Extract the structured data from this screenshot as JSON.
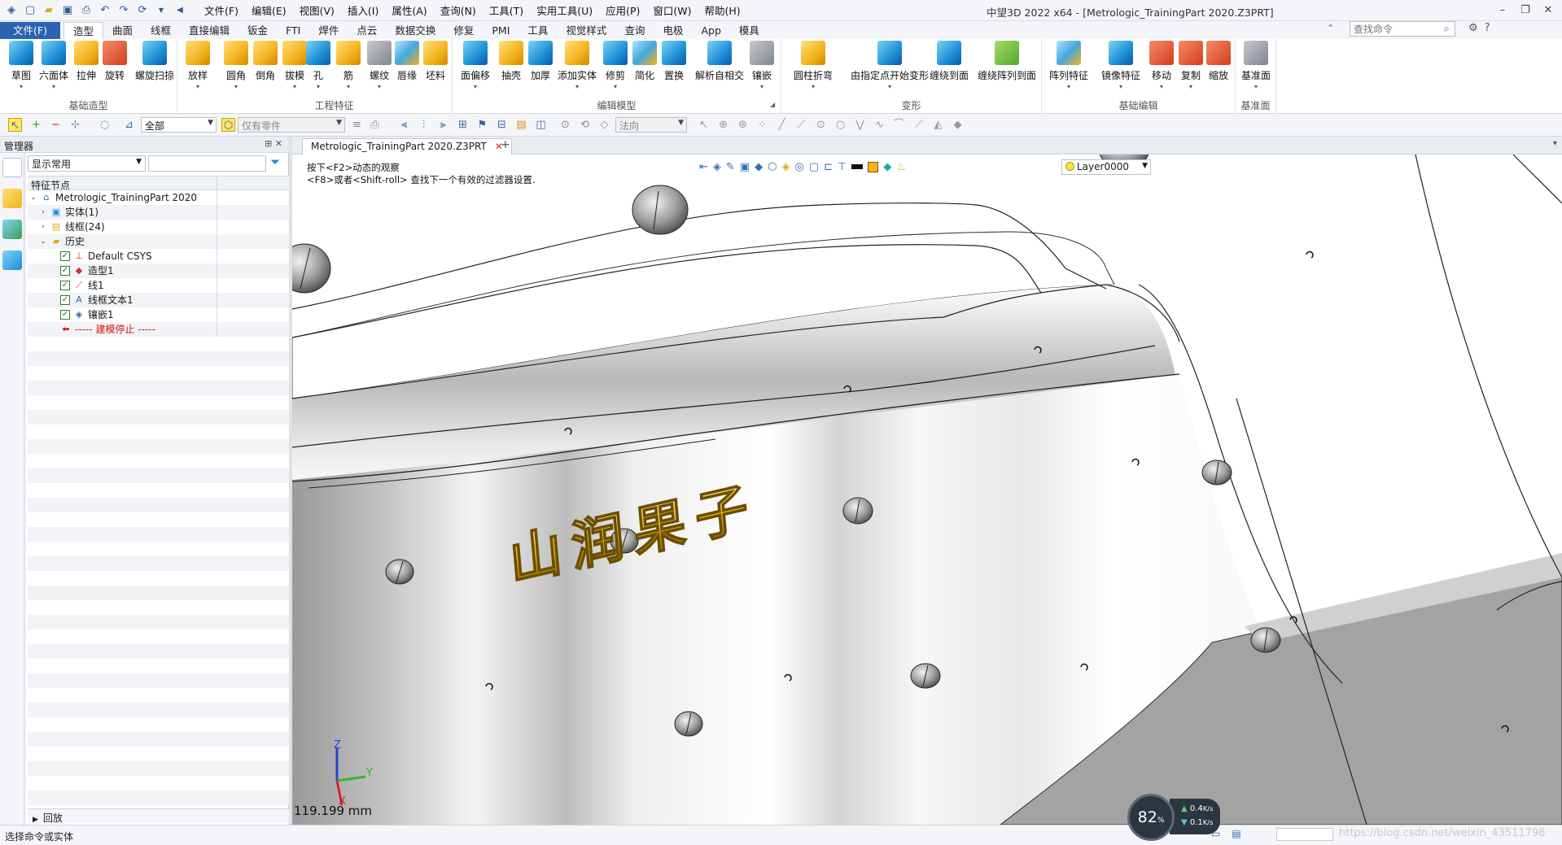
{
  "titlebar": {
    "window_title": "中望3D 2022 x64 - [Metrologic_TrainingPart 2020.Z3PRT]",
    "menus": [
      "文件(F)",
      "编辑(E)",
      "视图(V)",
      "插入(I)",
      "属性(A)",
      "查询(N)",
      "工具(T)",
      "实用工具(U)",
      "应用(P)",
      "窗口(W)",
      "帮助(H)"
    ]
  },
  "ribbon_tabs": [
    "文件(F)",
    "造型",
    "曲面",
    "线框",
    "直接编辑",
    "钣金",
    "FTI",
    "焊件",
    "点云",
    "数据交换",
    "修复",
    "PMI",
    "工具",
    "视觉样式",
    "查询",
    "电极",
    "App",
    "模具"
  ],
  "active_tab": "造型",
  "search": {
    "placeholder": "查找命令"
  },
  "groups": [
    {
      "label": "基础造型",
      "buttons": [
        "草图",
        "六面体",
        "拉伸",
        "旋转",
        "螺旋扫掠",
        "放样"
      ]
    },
    {
      "label": "工程特征",
      "buttons": [
        "圆角",
        "倒角",
        "拔模",
        "孔",
        "筋",
        "螺纹",
        "唇缘",
        "坯料"
      ]
    },
    {
      "label": "编辑模型",
      "buttons": [
        "面偏移",
        "抽壳",
        "加厚",
        "添加实体",
        "修剪",
        "简化",
        "置换",
        "解析自相交",
        "镶嵌"
      ]
    },
    {
      "label": "变形",
      "buttons": [
        "圆柱折弯",
        "由指定点开始变形",
        "缠绕到面",
        "缠绕阵列到面"
      ]
    },
    {
      "label": "基础编辑",
      "buttons": [
        "阵列特征",
        "镜像特征",
        "移动",
        "复制",
        "缩放"
      ]
    },
    {
      "label": "基准面",
      "buttons": [
        "基准面"
      ]
    }
  ],
  "toolbar2": {
    "filter_all": "全部",
    "part_filter": "仅有零件",
    "direction": "法向"
  },
  "manager": {
    "title": "管理器",
    "filter_select": "显示常用",
    "tree_header": "特征节点",
    "tree": [
      {
        "label": "Metrologic_TrainingPart 2020",
        "level": 0,
        "expand": "⌄",
        "icon": "part-icon",
        "check": false
      },
      {
        "label": "实体(1)",
        "level": 1,
        "expand": "›",
        "icon": "solid-icon",
        "check": false
      },
      {
        "label": "线框(24)",
        "level": 1,
        "expand": "›",
        "icon": "wireframe-icon",
        "check": false
      },
      {
        "label": "历史",
        "level": 1,
        "expand": "⌄",
        "icon": "folder-icon",
        "check": false
      },
      {
        "label": "Default CSYS",
        "level": 2,
        "expand": "",
        "icon": "csys-icon",
        "check": true
      },
      {
        "label": "造型1",
        "level": 2,
        "expand": "",
        "icon": "shape-icon",
        "check": true
      },
      {
        "label": "线1",
        "level": 2,
        "expand": "",
        "icon": "line-icon",
        "check": true
      },
      {
        "label": "线框文本1",
        "level": 2,
        "expand": "",
        "icon": "text-icon",
        "check": true
      },
      {
        "label": "镶嵌1",
        "level": 2,
        "expand": "",
        "icon": "emboss-icon",
        "check": true
      },
      {
        "label": "----- 建模停止 -----",
        "level": 2,
        "expand": "",
        "icon": "stop-arrow-icon",
        "check": false
      }
    ],
    "rollback": "回放"
  },
  "document": {
    "tab_title": "Metrologic_TrainingPart 2020.Z3PRT",
    "hint_line1": "按下<F2>动态的观察",
    "hint_line2": "<F8>或者<Shift-roll> 查找下一个有效的过滤器设置.",
    "layer": "Layer0000",
    "scale_readout": "119.199 mm",
    "emboss_text": "山润果子",
    "axis_x": "X",
    "axis_y": "Y",
    "axis_z": "Z"
  },
  "status": {
    "text": "选择命令或实体",
    "cpu_percent": "82",
    "cpu_unit": "%",
    "upload": "0.4",
    "download": "0.1",
    "rate_unit": "K/s",
    "watermark": "https://blog.csdn.net/weixin_43511798"
  },
  "colors": {
    "file_tab": "#2b63b3",
    "accent": "#1c8fd6",
    "emboss_gold": "#e2b21c"
  }
}
